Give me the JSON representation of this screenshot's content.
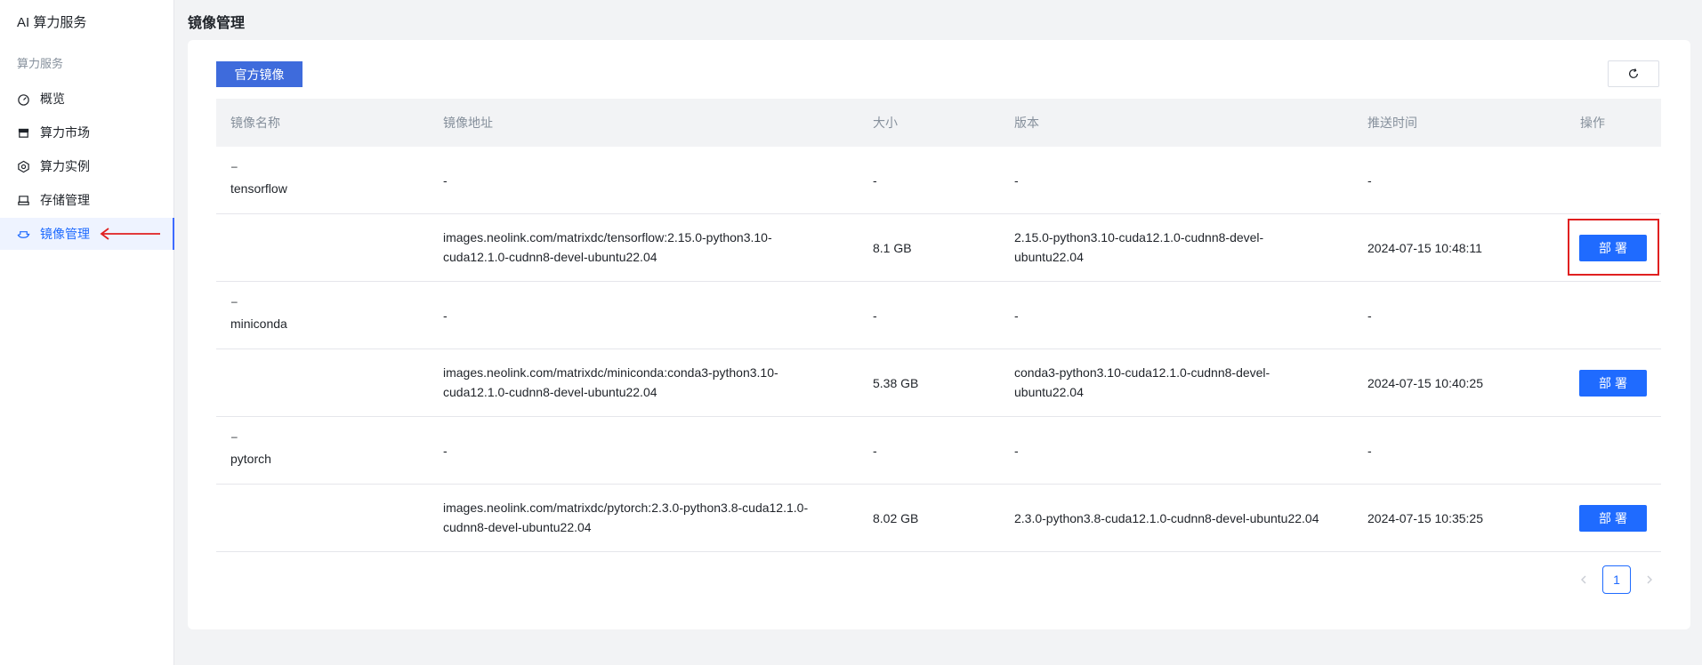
{
  "app": {
    "title": "AI 算力服务"
  },
  "sidebar": {
    "section_label": "算力服务",
    "items": [
      {
        "label": "概览",
        "icon": "dashboard-icon"
      },
      {
        "label": "算力市场",
        "icon": "store-icon"
      },
      {
        "label": "算力实例",
        "icon": "hexagon-icon"
      },
      {
        "label": "存储管理",
        "icon": "storage-icon"
      },
      {
        "label": "镜像管理",
        "icon": "image-icon",
        "active": true
      }
    ]
  },
  "page": {
    "title": "镜像管理"
  },
  "toolbar": {
    "tab_label": "官方镜像",
    "refresh_icon": "refresh-icon"
  },
  "table": {
    "headers": [
      "镜像名称",
      "镜像地址",
      "大小",
      "版本",
      "推送时间",
      "操作"
    ],
    "collapse_symbol": "–",
    "placeholder": "-",
    "groups": [
      {
        "name": "tensorflow",
        "child": {
          "address_line1": "images.neolink.com/matrixdc/tensorflow:2.15.0-python3.10-",
          "address_line2": "cuda12.1.0-cudnn8-devel-ubuntu22.04",
          "size": "8.1 GB",
          "version_line1": "2.15.0-python3.10-cuda12.1.0-cudnn8-devel-",
          "version_line2": "ubuntu22.04",
          "time": "2024-07-15 10:48:11",
          "action": "部署"
        }
      },
      {
        "name": "miniconda",
        "child": {
          "address_line1": "images.neolink.com/matrixdc/miniconda:conda3-python3.10-",
          "address_line2": "cuda12.1.0-cudnn8-devel-ubuntu22.04",
          "size": "5.38 GB",
          "version_line1": "conda3-python3.10-cuda12.1.0-cudnn8-devel-",
          "version_line2": "ubuntu22.04",
          "time": "2024-07-15 10:40:25",
          "action": "部署"
        }
      },
      {
        "name": "pytorch",
        "child": {
          "address_line1": "images.neolink.com/matrixdc/pytorch:2.3.0-python3.8-cuda12.1.0-",
          "address_line2": "cudnn8-devel-ubuntu22.04",
          "size": "8.02 GB",
          "version_line1": "2.3.0-python3.8-cuda12.1.0-cudnn8-devel-ubuntu22.04",
          "version_line2": "",
          "time": "2024-07-15 10:35:25",
          "action": "部署"
        }
      }
    ]
  },
  "pagination": {
    "current": "1"
  },
  "colors": {
    "primary": "#1f6bff",
    "tab": "#3e6bdc",
    "annotation": "#e02020"
  }
}
